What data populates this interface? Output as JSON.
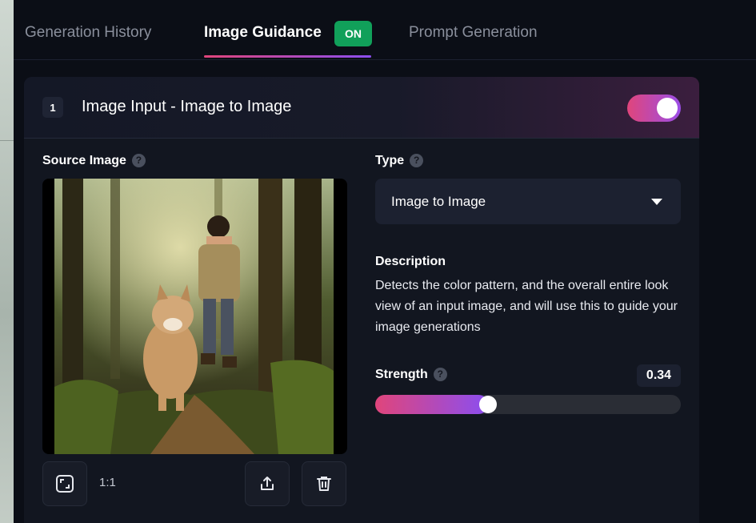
{
  "tabs": [
    {
      "label": "Generation History"
    },
    {
      "label": "Image Guidance",
      "badge": "ON"
    },
    {
      "label": "Prompt Generation"
    }
  ],
  "card": {
    "number": "1",
    "title": "Image Input - Image to Image",
    "enabled": true
  },
  "source": {
    "label": "Source Image",
    "help": "?",
    "ratio": "1:1"
  },
  "type": {
    "label": "Type",
    "help": "?",
    "value": "Image to Image"
  },
  "description": {
    "title": "Description",
    "text": "Detects the color pattern, and the overall entire look view of an input image, and will use this to guide your image generations"
  },
  "strength": {
    "label": "Strength",
    "help": "?",
    "value": "0.34",
    "fraction": 0.34
  },
  "colors": {
    "accent_start": "#e0457b",
    "accent_end": "#8b4ef0",
    "on_badge": "#11a05a"
  },
  "icons": [
    "aspect-ratio-icon",
    "upload-icon",
    "trash-icon",
    "chevron-down-icon",
    "help-icon"
  ]
}
